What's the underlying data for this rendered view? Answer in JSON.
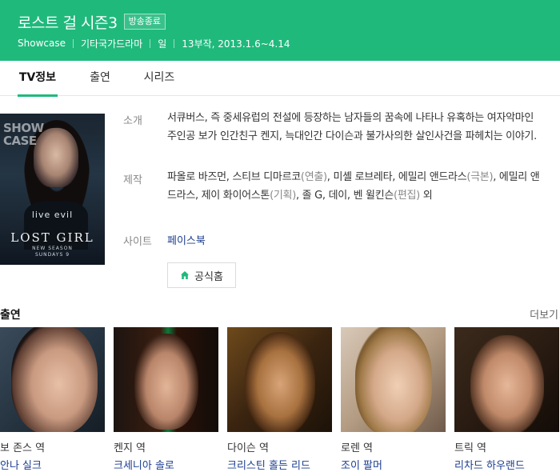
{
  "header": {
    "title": "로스트 걸 시즌3",
    "badge": "방송종료",
    "meta": [
      "Showcase",
      "기타국가드라마",
      "일",
      "13부작, 2013.1.6~4.14"
    ]
  },
  "tabs": [
    {
      "label": "TV정보",
      "active": true
    },
    {
      "label": "출연",
      "active": false
    },
    {
      "label": "시리즈",
      "active": false
    }
  ],
  "poster": {
    "corner_text": "SHOW\nCASE",
    "tagline": "live evil",
    "logo": "LOST GIRL",
    "sub": "NEW SEASON\nSUNDAYS 9"
  },
  "info": {
    "intro_label": "소개",
    "intro_text": "서큐버스, 즉 중세유럽의 전설에 등장하는 남자들의 꿈속에 나타나 유혹하는 여자악마인 주인공 보가 인간친구 켄지, 늑대인간 다이슨과 불가사의한 살인사건을 파헤치는 이야기.",
    "production_label": "제작",
    "production": [
      {
        "name": "파올로 바즈먼, 스티브 디마르코",
        "role": "(연출)"
      },
      {
        "name": ", 미셸 로브레타, 에밀리 앤드라스",
        "role": "(극본)"
      },
      {
        "name": ", 에밀리 앤드라스, 제이 화이어스톤",
        "role": "(기획)"
      },
      {
        "name": ", 졸 G, 데이, 벤 윌킨슨",
        "role": "(편집)"
      },
      {
        "name": " 외",
        "role": ""
      }
    ],
    "site_label": "사이트",
    "site_link": "페이스북",
    "home_button": "공식홈"
  },
  "cast": {
    "title": "출연",
    "more": "더보기",
    "items": [
      {
        "role": "보 존스 역",
        "actor": "안나 실크"
      },
      {
        "role": "켄지 역",
        "actor": "크세니아 솔로"
      },
      {
        "role": "다이슨 역",
        "actor": "크리스틴 홀든 리드"
      },
      {
        "role": "로렌 역",
        "actor": "조이 팔머"
      },
      {
        "role": "트릭 역",
        "actor": "리차드 하우랜드"
      }
    ]
  },
  "colors": {
    "brand": "#1fb97c",
    "link": "#1b3d8f"
  },
  "icons": [
    "home-icon"
  ]
}
